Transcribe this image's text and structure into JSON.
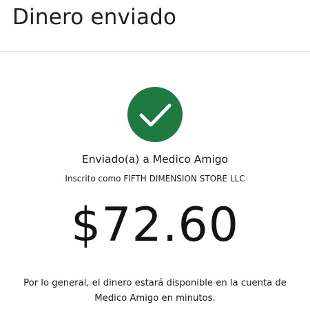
{
  "header": {
    "title": "Dinero enviado"
  },
  "status": {
    "icon": "checkmark-icon",
    "color": "#1f7a42"
  },
  "recipient": {
    "sent_to": "Enviado(a) a Medico Amigo",
    "registered_as": "Inscrito como FIFTH DIMENSION STORE LLC"
  },
  "payment": {
    "amount": "$72.60"
  },
  "note": {
    "availability": "Por lo general, el dinero estará disponible en la cuenta de Medico Amigo en minutos."
  }
}
